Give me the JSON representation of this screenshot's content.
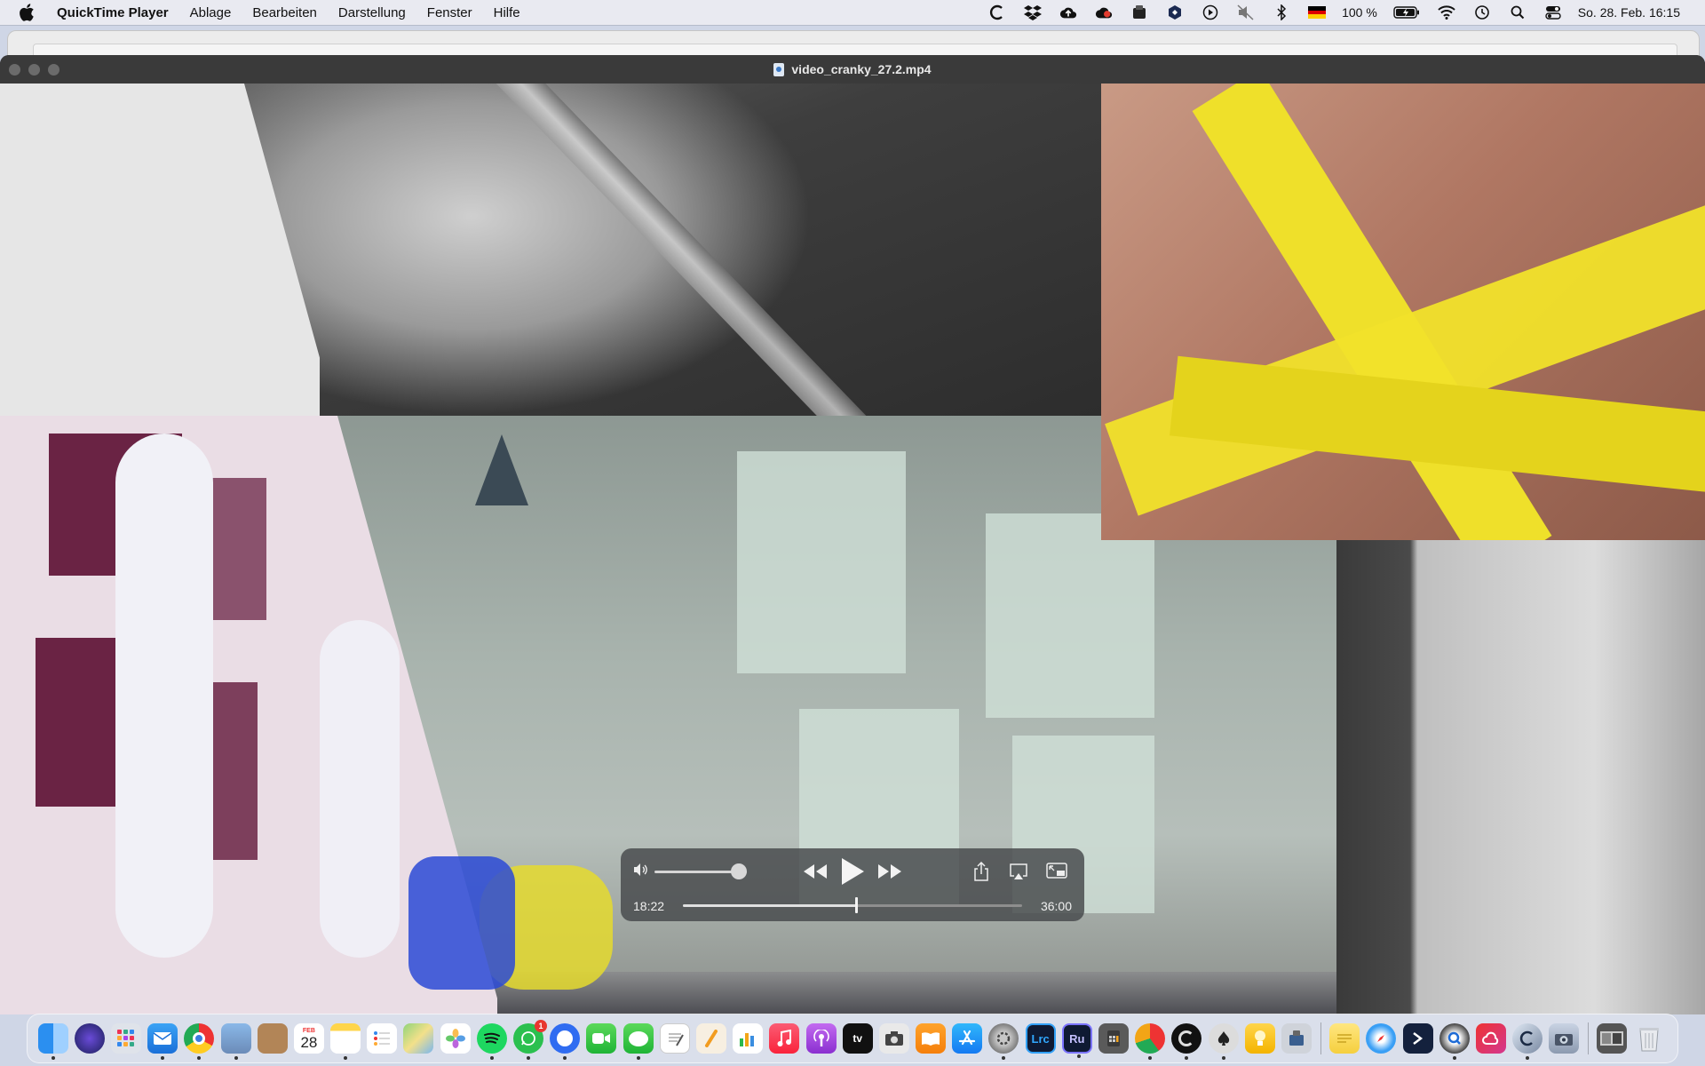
{
  "menubar": {
    "app_name": "QuickTime Player",
    "items": [
      "Ablage",
      "Bearbeiten",
      "Darstellung",
      "Fenster",
      "Hilfe"
    ],
    "battery_text": "100 %",
    "datetime": "So. 28. Feb.  16:15"
  },
  "window": {
    "title": "video_cranky_27.2.mp4"
  },
  "player": {
    "current_time": "18:22",
    "total_time": "36:00",
    "progress": 0.51,
    "volume": 0.85
  },
  "dock": {
    "calendar_month": "FEB",
    "calendar_day": "28",
    "whatsapp_badge": "1",
    "lightroom_label": "Lrc",
    "rush_label": "Ru",
    "appletv_label": "tv"
  },
  "colors": {
    "menubar_bg": "#e9eaf1",
    "titlebar_bg": "#3a3a3a",
    "hud_bg": "rgba(70,72,74,0.82)"
  }
}
